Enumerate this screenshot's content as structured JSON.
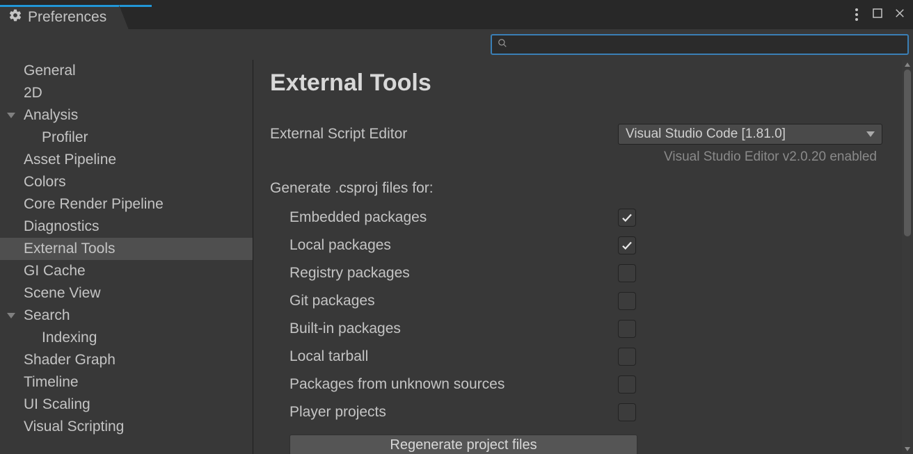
{
  "tab": {
    "title": "Preferences"
  },
  "search": {
    "value": ""
  },
  "sidebar": {
    "items": [
      {
        "label": "General",
        "indent": 0,
        "caret": false,
        "selected": false
      },
      {
        "label": "2D",
        "indent": 0,
        "caret": false,
        "selected": false
      },
      {
        "label": "Analysis",
        "indent": 0,
        "caret": true,
        "selected": false
      },
      {
        "label": "Profiler",
        "indent": 1,
        "caret": false,
        "selected": false
      },
      {
        "label": "Asset Pipeline",
        "indent": 0,
        "caret": false,
        "selected": false
      },
      {
        "label": "Colors",
        "indent": 0,
        "caret": false,
        "selected": false
      },
      {
        "label": "Core Render Pipeline",
        "indent": 0,
        "caret": false,
        "selected": false
      },
      {
        "label": "Diagnostics",
        "indent": 0,
        "caret": false,
        "selected": false
      },
      {
        "label": "External Tools",
        "indent": 0,
        "caret": false,
        "selected": true
      },
      {
        "label": "GI Cache",
        "indent": 0,
        "caret": false,
        "selected": false
      },
      {
        "label": "Scene View",
        "indent": 0,
        "caret": false,
        "selected": false
      },
      {
        "label": "Search",
        "indent": 0,
        "caret": true,
        "selected": false
      },
      {
        "label": "Indexing",
        "indent": 1,
        "caret": false,
        "selected": false
      },
      {
        "label": "Shader Graph",
        "indent": 0,
        "caret": false,
        "selected": false
      },
      {
        "label": "Timeline",
        "indent": 0,
        "caret": false,
        "selected": false
      },
      {
        "label": "UI Scaling",
        "indent": 0,
        "caret": false,
        "selected": false
      },
      {
        "label": "Visual Scripting",
        "indent": 0,
        "caret": false,
        "selected": false
      }
    ]
  },
  "main": {
    "page_title": "External Tools",
    "editor_row": {
      "label": "External Script Editor",
      "value": "Visual Studio Code [1.81.0]"
    },
    "status_note": "Visual Studio Editor v2.0.20 enabled",
    "csproj_section_label": "Generate .csproj files for:",
    "csproj_options": [
      {
        "label": "Embedded packages",
        "checked": true
      },
      {
        "label": "Local packages",
        "checked": true
      },
      {
        "label": "Registry packages",
        "checked": false
      },
      {
        "label": "Git packages",
        "checked": false
      },
      {
        "label": "Built-in packages",
        "checked": false
      },
      {
        "label": "Local tarball",
        "checked": false
      },
      {
        "label": "Packages from unknown sources",
        "checked": false
      },
      {
        "label": "Player projects",
        "checked": false
      }
    ],
    "regenerate_button": "Regenerate project files"
  }
}
